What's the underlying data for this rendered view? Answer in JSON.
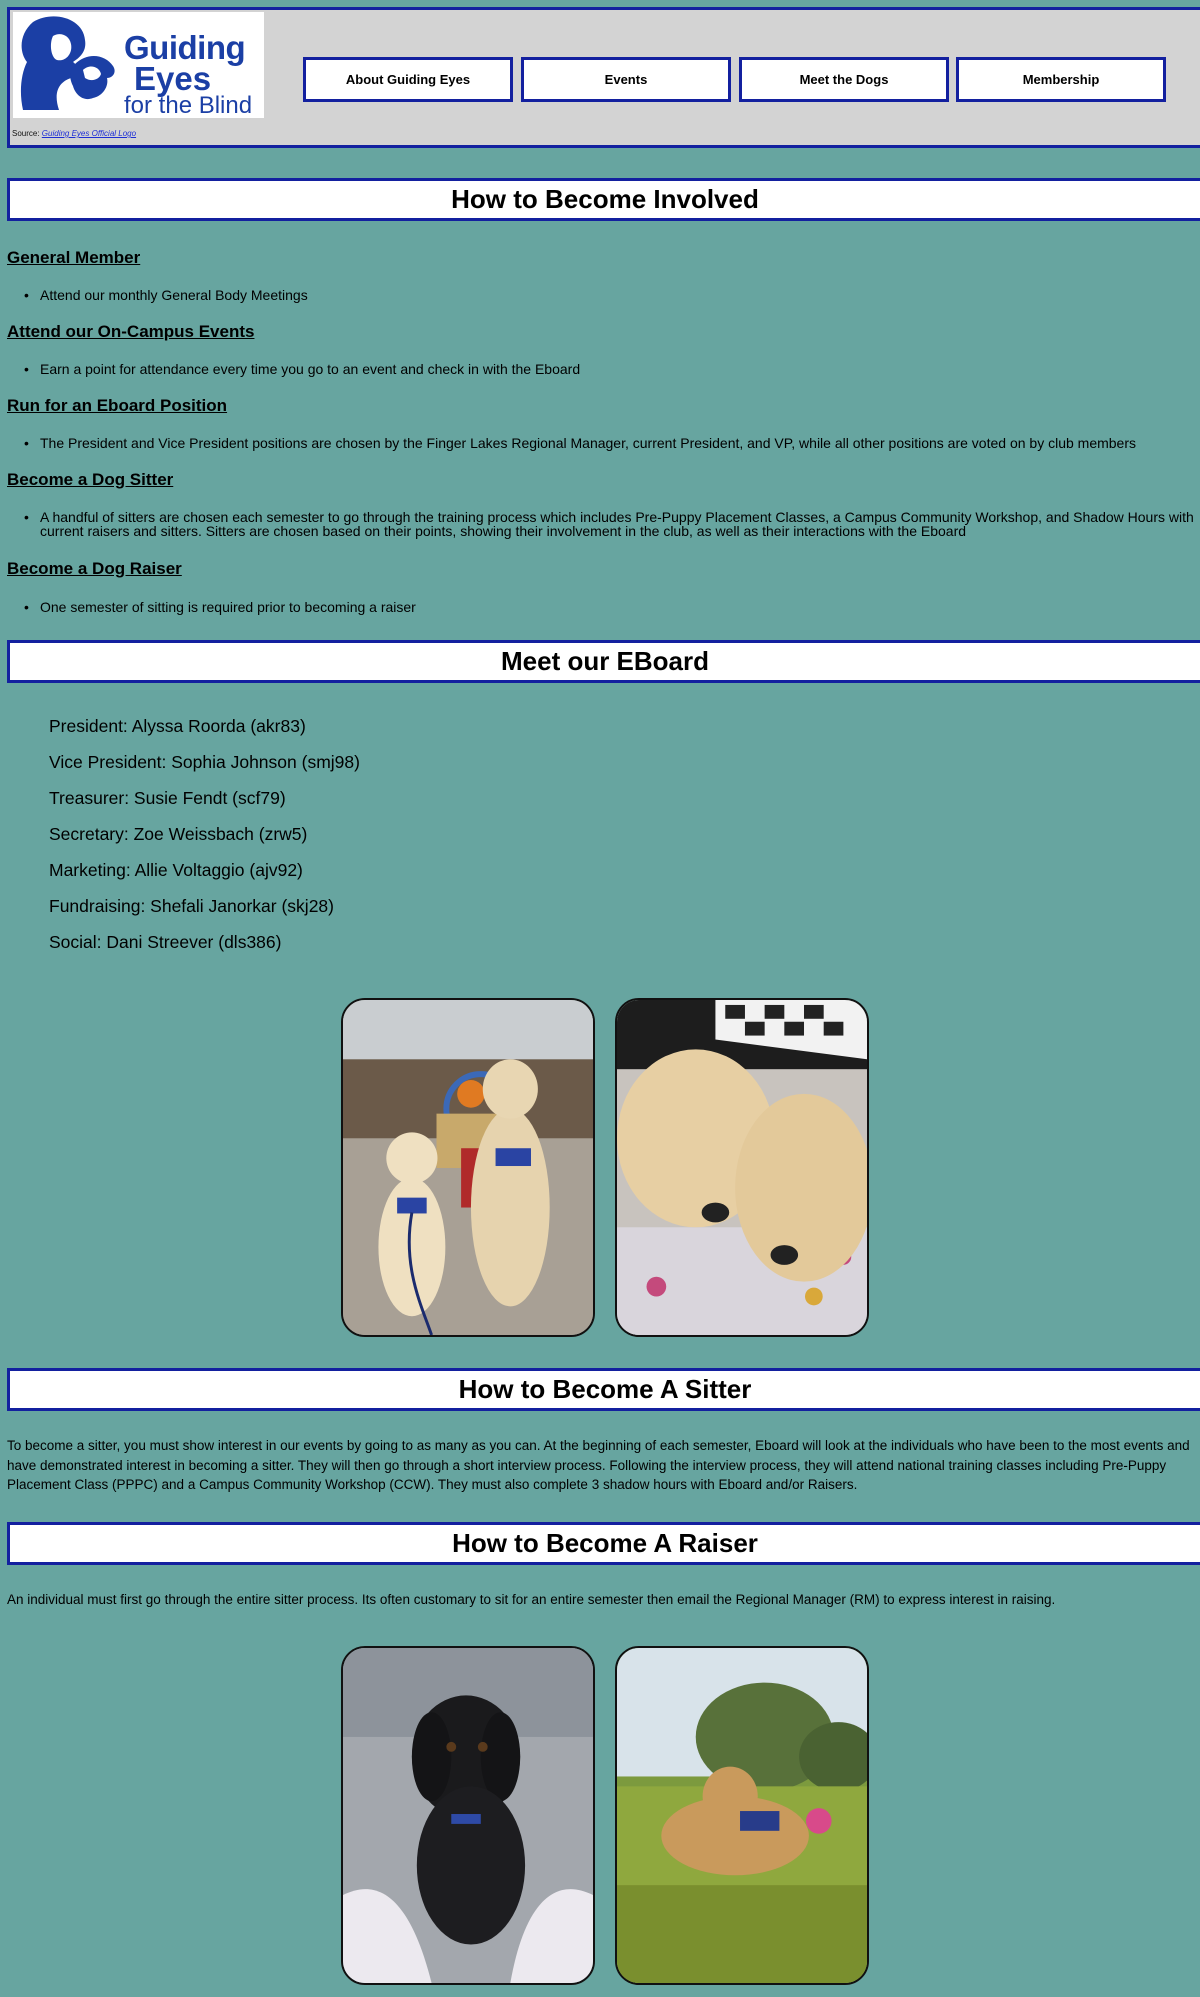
{
  "header": {
    "logo": {
      "line1": "Guiding",
      "line2": "Eyes",
      "line3": "for the Blind"
    },
    "source_prefix": "Source: ",
    "source_link": "Guiding Eyes Official Logo",
    "nav": [
      "About Guiding Eyes",
      "Events",
      "Meet the Dogs",
      "Membership"
    ]
  },
  "involved": {
    "title": "How to Become Involved",
    "sections": [
      {
        "heading": "General Member",
        "bullet": "Attend our monthly General Body Meetings"
      },
      {
        "heading": "Attend our On-Campus Events",
        "bullet": "Earn a point for attendance every time you go to an event and check in with the Eboard"
      },
      {
        "heading": "Run for an Eboard Position",
        "bullet": "The President and Vice President positions are chosen by the Finger Lakes Regional Manager, current President, and VP, while all other positions are voted on by club members"
      },
      {
        "heading": "Become a Dog Sitter",
        "bullet": "A handful of sitters are chosen each semester to go through the training process which includes Pre-Puppy Placement Classes, a Campus Community Workshop, and Shadow Hours with current raisers and sitters. Sitters are chosen based on their points, showing their involvement in the club, as well as their interactions with the Eboard"
      },
      {
        "heading": "Become a Dog Raiser",
        "bullet": "One semester of sitting is required prior to becoming a raiser"
      }
    ]
  },
  "eboard": {
    "title": "Meet our EBoard",
    "members": [
      "President: Alyssa Roorda (akr83)",
      "Vice President: Sophia Johnson (smj98)",
      "Treasurer: Susie Fendt (scf79)",
      "Secretary: Zoe Weissbach (zrw5)",
      "Marketing: Allie Voltaggio (ajv92)",
      "Fundraising: Shefali Janorkar (skj28)",
      "Social: Dani Streever (dls386)"
    ]
  },
  "sitter": {
    "title": "How to Become A Sitter",
    "text": "To become a sitter, you must show interest in our events by going to as many as you can. At the beginning of each semester, Eboard will look at the individuals who have been to the most events and have demonstrated interest in becoming a sitter. They will then go through a short interview process. Following the interview process, they will attend national training classes including Pre-Puppy Placement Class (PPPC) and a Campus Community Workshop (CCW). They must also complete 3 shadow hours with Eboard and/or Raisers."
  },
  "raiser": {
    "title": "How to Become A Raiser",
    "text": "An individual must first go through the entire sitter process. Its often customary to sit for an entire semester then email the Regional Manager (RM) to express interest in raising."
  },
  "colors": {
    "page_bg": "#67a5a0",
    "accent": "#13209f",
    "header_bg": "#d3d3d3",
    "logo_blue": "#1b3fa5"
  }
}
